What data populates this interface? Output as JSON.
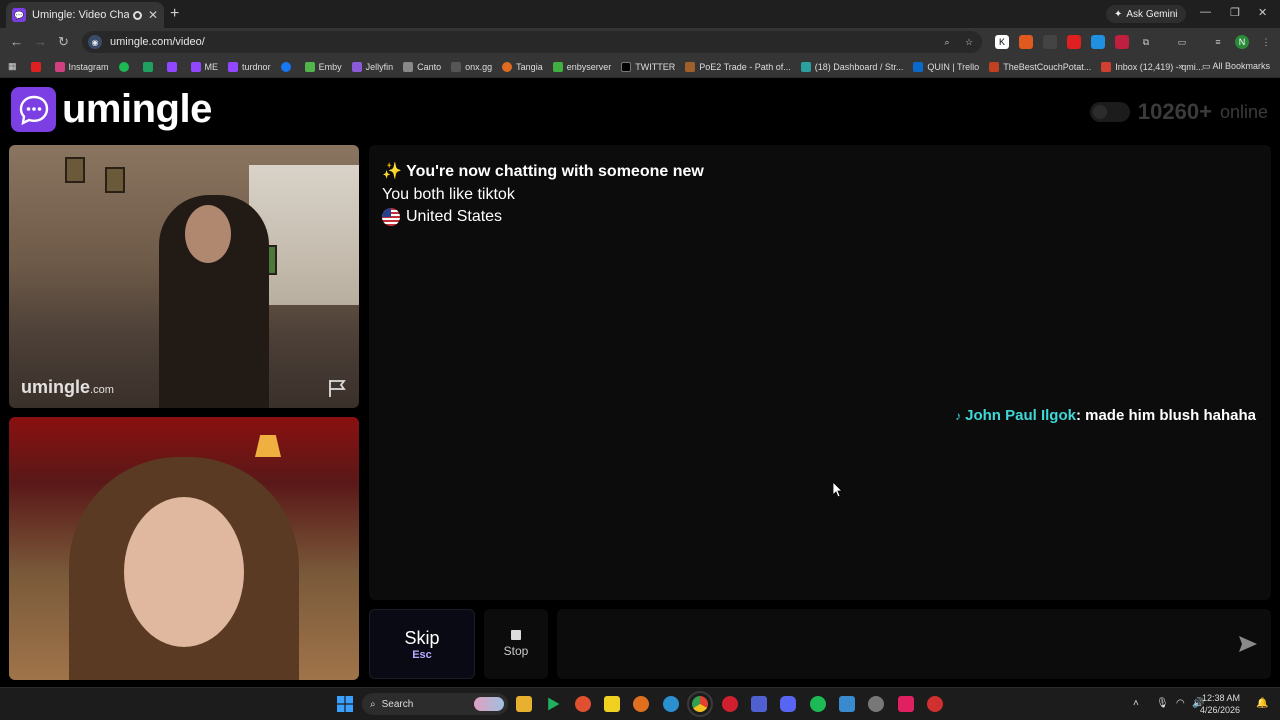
{
  "browser": {
    "tab_title": "Umingle: Video Chat with S",
    "url": "umingle.com/video/",
    "gemini_label": "Ask Gemini",
    "all_bookmarks": "All Bookmarks",
    "bookmarks": [
      "Instagram",
      "ME",
      "turdnor",
      "Emby",
      "Jellyfin",
      "Canto",
      "onx.gg",
      "Tangia",
      "enbyserver",
      "TWITTER",
      "PoE2 Trade - Path of...",
      "(18) Dashboard / Str...",
      "QUIN | Trello",
      "TheBestCouchPotat...",
      "Inbox (12,419) - qmi..."
    ]
  },
  "site": {
    "logo_text": "umingle",
    "online_count": "10260+",
    "online_label": "online",
    "watermark": "umingle",
    "watermark_suffix": ".com"
  },
  "chat": {
    "system_new": "✨ You're now chatting with someone new",
    "system_interest": "You both like tiktok",
    "system_country": "United States",
    "message": {
      "sender": "John Paul Ilgok",
      "text": ": made him blush hahaha"
    }
  },
  "controls": {
    "skip_label": "Skip",
    "skip_hint": "Esc",
    "stop_label": "Stop",
    "message_placeholder": ""
  },
  "taskbar": {
    "search_label": "Search",
    "time": "12:38 AM",
    "date": "4/26/2026"
  },
  "colors": {
    "brand": "#7b3fe4",
    "sender": "#3fd8d8",
    "skip_hint": "#b8a8ff"
  }
}
